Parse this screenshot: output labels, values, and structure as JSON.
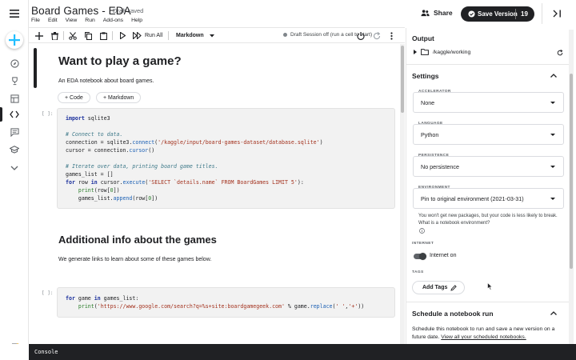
{
  "header": {
    "title": "Board Games - EDA",
    "draft_status": "Draft saved",
    "menu": [
      "File",
      "Edit",
      "View",
      "Run",
      "Add-ons",
      "Help"
    ],
    "share_label": "Share",
    "save_label": "Save Version",
    "version_count": "19"
  },
  "toolbar": {
    "run_all_label": "Run All",
    "cell_type": "Markdown",
    "session_status": "Draft Session off (run a cell to start)"
  },
  "notebook": {
    "heading1": "Want to play a game?",
    "intro_text": "An EDA notebook about board games.",
    "add_code_label": "+ Code",
    "add_markdown_label": "+ Markdown",
    "prompt1": "[ ]:",
    "code1": {
      "line1_kw": "import",
      "line1_rest": " sqlite3",
      "line3_comment": "# Connect to data.",
      "line4_a": "connection = sqlite3.",
      "line4_fn": "connect",
      "line4_b": "(",
      "line4_str": "'/kaggle/input/board-games-dataset/database.sqlite'",
      "line4_c": ")",
      "line5_a": "cursor = connection.",
      "line5_fn": "cursor",
      "line5_b": "()",
      "line7_comment": "# Iterate over data, printing board game titles.",
      "line8": "games_list = []",
      "line9_kw1": "for",
      "line9_a": " row ",
      "line9_kw2": "in",
      "line9_b": " cursor.",
      "line9_fn": "execute",
      "line9_c": "(",
      "line9_str": "'SELECT `details.name` FROM BoardGames LIMIT 5'",
      "line9_d": "):",
      "line10_a": "    ",
      "line10_fn": "print",
      "line10_b": "(row[",
      "line10_num": "0",
      "line10_c": "])",
      "line11_a": "    games_list.",
      "line11_fn": "append",
      "line11_b": "(row[",
      "line11_num": "0",
      "line11_c": "])"
    },
    "heading2": "Additional info about the games",
    "info_text": "We generate links to learn about some of these games below.",
    "prompt2": "[ ]:",
    "code2": {
      "line1_kw1": "for",
      "line1_a": " game ",
      "line1_kw2": "in",
      "line1_b": " games_list:",
      "line2_a": "    ",
      "line2_fn": "print",
      "line2_b": "(",
      "line2_str": "'https://www.google.com/search?q=%s+site:boardgamegeek.com'",
      "line2_c": " % game.",
      "line2_fn2": "replace",
      "line2_d": "(",
      "line2_str2": "' '",
      "line2_e": ",",
      "line2_str3": "'+'",
      "line2_f": "))"
    }
  },
  "panel": {
    "output_title": "Output",
    "output_path": "/kaggle/working",
    "settings_title": "Settings",
    "accelerator_label": "ACCELERATOR",
    "accelerator_value": "None",
    "language_label": "LANGUAGE",
    "language_value": "Python",
    "persistence_label": "PERSISTENCE",
    "persistence_value": "No persistence",
    "environment_label": "ENVIRONMENT",
    "environment_value": "Pin to original environment (2021-03-31)",
    "environment_note": "You won't get new packages, but your code is less likely to break. What is a notebook environment?",
    "internet_label": "INTERNET",
    "internet_value": "Internet on",
    "tags_label": "TAGS",
    "add_tags_label": "Add Tags",
    "schedule_title": "Schedule a notebook run",
    "schedule_text": "Schedule this notebook to run and save a new version on a future date.",
    "schedule_link": "View all your scheduled notebooks."
  },
  "console": {
    "label": "Console"
  },
  "colors": {
    "dark": "#202124",
    "accent": "#20beff"
  },
  "icons": [
    "menu-icon",
    "plus-icon",
    "compass-icon",
    "trophy-icon",
    "table-icon",
    "code-icon",
    "comment-icon",
    "school-icon",
    "chevron-down-icon",
    "notifications-icon",
    "share-icon",
    "save-icon",
    "collapse-panel-icon"
  ]
}
